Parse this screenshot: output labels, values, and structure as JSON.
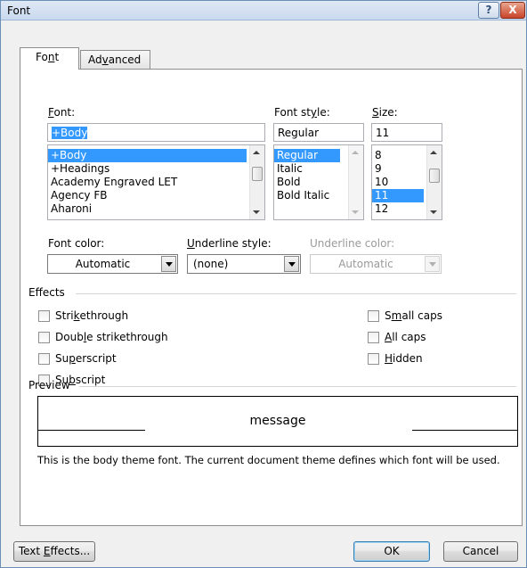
{
  "window": {
    "title": "Font",
    "help_label": "?",
    "close_label": "X"
  },
  "tabs": [
    {
      "pre": "Fo",
      "mn": "n",
      "post": "t"
    },
    {
      "pre": "Ad",
      "mn": "v",
      "post": "anced"
    }
  ],
  "font": {
    "label_mn": "F",
    "label_post": "ont:",
    "value": "+Body",
    "items": [
      "+Body",
      "+Headings",
      "Academy Engraved LET",
      "Agency FB",
      "Aharoni"
    ],
    "selected_index": 0
  },
  "font_style": {
    "label_pre": "Font st",
    "label_mn": "y",
    "label_post": "le:",
    "value": "Regular",
    "items": [
      "Regular",
      "Italic",
      "Bold",
      "Bold Italic"
    ],
    "selected_index": 0
  },
  "size": {
    "label_mn": "S",
    "label_post": "ize:",
    "value": "11",
    "items": [
      "8",
      "9",
      "10",
      "11",
      "12"
    ],
    "selected_index": 3
  },
  "font_color": {
    "label": "Font color:",
    "value": "Automatic"
  },
  "underline_style": {
    "label_mn": "U",
    "label_post": "nderline style:",
    "value": "(none)"
  },
  "underline_color": {
    "label": "Underline color:",
    "value": "Automatic"
  },
  "effects": {
    "heading": "Effects",
    "left": [
      {
        "pre": "Stri",
        "mn": "k",
        "post": "ethrough"
      },
      {
        "pre": "Doub",
        "mn": "l",
        "post": "e strikethrough"
      },
      {
        "pre": "Su",
        "mn": "p",
        "post": "erscript"
      },
      {
        "pre": "Su",
        "mn": "b",
        "post": "script"
      }
    ],
    "right": [
      {
        "pre": "S",
        "mn": "m",
        "post": "all caps"
      },
      {
        "pre": "",
        "mn": "A",
        "post": "ll caps"
      },
      {
        "pre": "",
        "mn": "H",
        "post": "idden"
      }
    ]
  },
  "preview": {
    "heading": "Preview",
    "sample": "message",
    "description": "This is the body theme font. The current document theme defines which font will be used."
  },
  "buttons": {
    "text_effects_pre": "Text ",
    "text_effects_mn": "E",
    "text_effects_post": "ffects...",
    "ok": "OK",
    "cancel": "Cancel"
  }
}
